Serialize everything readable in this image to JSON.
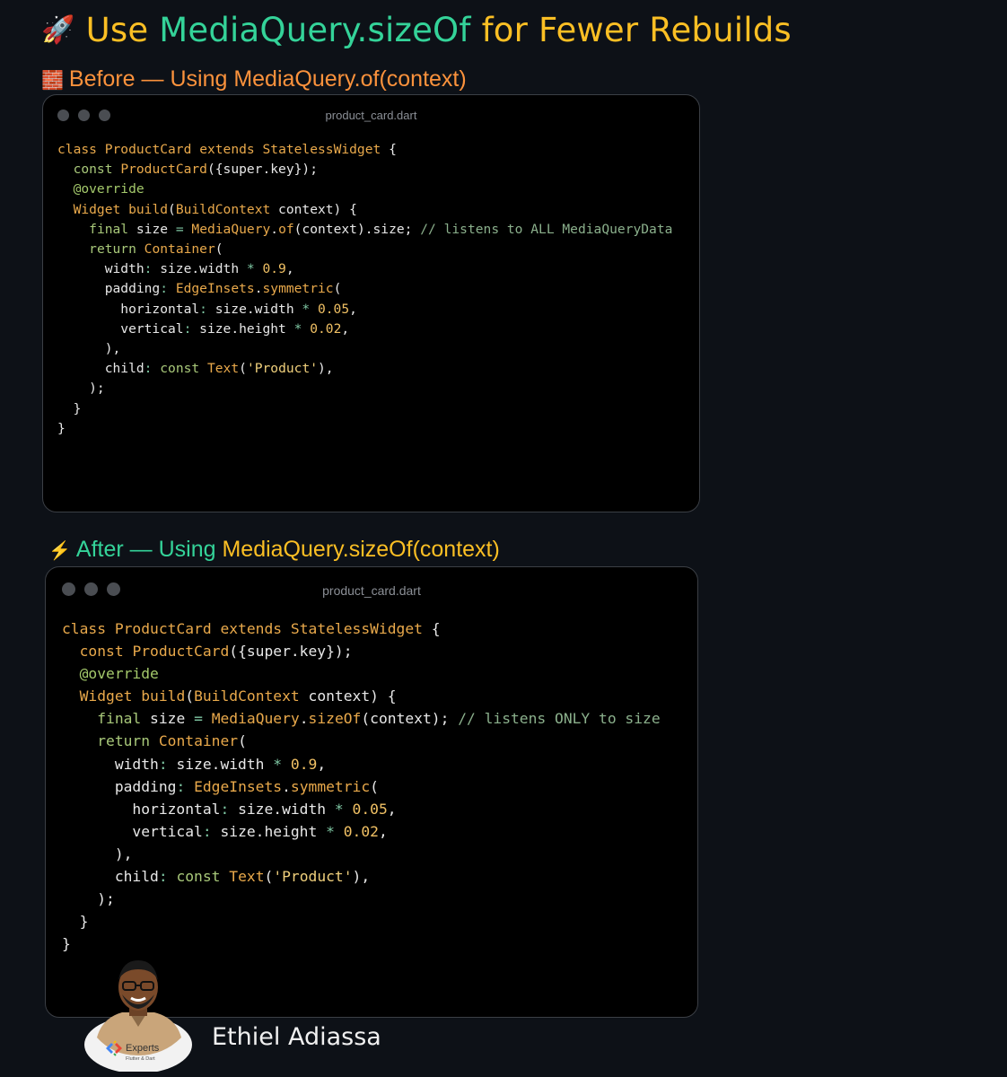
{
  "header": {
    "emoji": "🚀",
    "title_part1": "Use ",
    "title_part2": "MediaQuery.sizeOf",
    "title_part3": " for Fewer Rebuilds"
  },
  "before": {
    "emoji": "🧱",
    "label_part1": "Before — Using ",
    "label_part2": "MediaQuery.of(context)",
    "filename": "product_card.dart",
    "code_lines": [
      [
        [
          "kw",
          "class"
        ],
        [
          "p",
          " "
        ],
        [
          "type",
          "ProductCard"
        ],
        [
          "p",
          " "
        ],
        [
          "kw",
          "extends"
        ],
        [
          "p",
          " "
        ],
        [
          "type",
          "StatelessWidget"
        ],
        [
          "p",
          " {"
        ]
      ],
      [
        [
          "p",
          "  "
        ],
        [
          "kw2",
          "const"
        ],
        [
          "p",
          " "
        ],
        [
          "fn",
          "ProductCard"
        ],
        [
          "p",
          "({super.key});"
        ]
      ],
      [
        [
          "p",
          ""
        ]
      ],
      [
        [
          "p",
          "  "
        ],
        [
          "ann",
          "@override"
        ]
      ],
      [
        [
          "p",
          "  "
        ],
        [
          "type",
          "Widget"
        ],
        [
          "p",
          " "
        ],
        [
          "fn",
          "build"
        ],
        [
          "p",
          "("
        ],
        [
          "type",
          "BuildContext"
        ],
        [
          "p",
          " context) {"
        ]
      ],
      [
        [
          "p",
          "    "
        ],
        [
          "kw2",
          "final"
        ],
        [
          "p",
          " size "
        ],
        [
          "op",
          "="
        ],
        [
          "p",
          " "
        ],
        [
          "type",
          "MediaQuery"
        ],
        [
          "p",
          "."
        ],
        [
          "fn",
          "of"
        ],
        [
          "p",
          "(context).size; "
        ],
        [
          "comment",
          "// listens to ALL MediaQueryData"
        ]
      ],
      [
        [
          "p",
          ""
        ]
      ],
      [
        [
          "p",
          "    "
        ],
        [
          "kw2",
          "return"
        ],
        [
          "p",
          " "
        ],
        [
          "type",
          "Container"
        ],
        [
          "p",
          "("
        ]
      ],
      [
        [
          "p",
          "      width"
        ],
        [
          "op",
          ":"
        ],
        [
          "p",
          " size.width "
        ],
        [
          "op",
          "*"
        ],
        [
          "p",
          " "
        ],
        [
          "num",
          "0.9"
        ],
        [
          "p",
          ","
        ]
      ],
      [
        [
          "p",
          "      padding"
        ],
        [
          "op",
          ":"
        ],
        [
          "p",
          " "
        ],
        [
          "type",
          "EdgeInsets"
        ],
        [
          "p",
          "."
        ],
        [
          "fn",
          "symmetric"
        ],
        [
          "p",
          "("
        ]
      ],
      [
        [
          "p",
          "        horizontal"
        ],
        [
          "op",
          ":"
        ],
        [
          "p",
          " size.width "
        ],
        [
          "op",
          "*"
        ],
        [
          "p",
          " "
        ],
        [
          "num",
          "0.05"
        ],
        [
          "p",
          ","
        ]
      ],
      [
        [
          "p",
          "        vertical"
        ],
        [
          "op",
          ":"
        ],
        [
          "p",
          " size.height "
        ],
        [
          "op",
          "*"
        ],
        [
          "p",
          " "
        ],
        [
          "num",
          "0.02"
        ],
        [
          "p",
          ","
        ]
      ],
      [
        [
          "p",
          "      ),"
        ]
      ],
      [
        [
          "p",
          "      child"
        ],
        [
          "op",
          ":"
        ],
        [
          "p",
          " "
        ],
        [
          "kw2",
          "const"
        ],
        [
          "p",
          " "
        ],
        [
          "type",
          "Text"
        ],
        [
          "p",
          "("
        ],
        [
          "str",
          "'Product'"
        ],
        [
          "p",
          "),"
        ]
      ],
      [
        [
          "p",
          "    );"
        ]
      ],
      [
        [
          "p",
          "  }"
        ]
      ],
      [
        [
          "p",
          "}"
        ]
      ]
    ]
  },
  "after": {
    "emoji": "⚡",
    "label_part1": "After — Using ",
    "label_part2": "MediaQuery.sizeOf(context)",
    "filename": "product_card.dart",
    "code_lines": [
      [
        [
          "kw",
          "class"
        ],
        [
          "p",
          " "
        ],
        [
          "type",
          "ProductCard"
        ],
        [
          "p",
          " "
        ],
        [
          "kw",
          "extends"
        ],
        [
          "p",
          " "
        ],
        [
          "type",
          "StatelessWidget"
        ],
        [
          "p",
          " {"
        ]
      ],
      [
        [
          "p",
          "  "
        ],
        [
          "kw",
          "const"
        ],
        [
          "p",
          " "
        ],
        [
          "fn",
          "ProductCard"
        ],
        [
          "p",
          "({super.key});"
        ]
      ],
      [
        [
          "p",
          ""
        ]
      ],
      [
        [
          "p",
          "  "
        ],
        [
          "ann",
          "@override"
        ]
      ],
      [
        [
          "p",
          "  "
        ],
        [
          "type",
          "Widget"
        ],
        [
          "p",
          " "
        ],
        [
          "fn",
          "build"
        ],
        [
          "p",
          "("
        ],
        [
          "type",
          "BuildContext"
        ],
        [
          "p",
          " context) {"
        ]
      ],
      [
        [
          "p",
          "    "
        ],
        [
          "kw2",
          "final"
        ],
        [
          "p",
          " size "
        ],
        [
          "op",
          "="
        ],
        [
          "p",
          " "
        ],
        [
          "type",
          "MediaQuery"
        ],
        [
          "p",
          "."
        ],
        [
          "fn",
          "sizeOf"
        ],
        [
          "p",
          "(context); "
        ],
        [
          "comment",
          "// listens ONLY to size"
        ]
      ],
      [
        [
          "p",
          ""
        ]
      ],
      [
        [
          "p",
          "    "
        ],
        [
          "kw2",
          "return"
        ],
        [
          "p",
          " "
        ],
        [
          "type",
          "Container"
        ],
        [
          "p",
          "("
        ]
      ],
      [
        [
          "p",
          "      width"
        ],
        [
          "op",
          ":"
        ],
        [
          "p",
          " size.width "
        ],
        [
          "op",
          "*"
        ],
        [
          "p",
          " "
        ],
        [
          "num",
          "0.9"
        ],
        [
          "p",
          ","
        ]
      ],
      [
        [
          "p",
          "      padding"
        ],
        [
          "op",
          ":"
        ],
        [
          "p",
          " "
        ],
        [
          "type",
          "EdgeInsets"
        ],
        [
          "p",
          "."
        ],
        [
          "fn",
          "symmetric"
        ],
        [
          "p",
          "("
        ]
      ],
      [
        [
          "p",
          "        horizontal"
        ],
        [
          "op",
          ":"
        ],
        [
          "p",
          " size.width "
        ],
        [
          "op",
          "*"
        ],
        [
          "p",
          " "
        ],
        [
          "num",
          "0.05"
        ],
        [
          "p",
          ","
        ]
      ],
      [
        [
          "p",
          "        vertical"
        ],
        [
          "op",
          ":"
        ],
        [
          "p",
          " size.height "
        ],
        [
          "op",
          "*"
        ],
        [
          "p",
          " "
        ],
        [
          "num",
          "0.02"
        ],
        [
          "p",
          ","
        ]
      ],
      [
        [
          "p",
          "      ),"
        ]
      ],
      [
        [
          "p",
          "      child"
        ],
        [
          "op",
          ":"
        ],
        [
          "p",
          " "
        ],
        [
          "kw2",
          "const"
        ],
        [
          "p",
          " "
        ],
        [
          "type",
          "Text"
        ],
        [
          "p",
          "("
        ],
        [
          "str",
          "'Product'"
        ],
        [
          "p",
          "),"
        ]
      ],
      [
        [
          "p",
          "    );"
        ]
      ],
      [
        [
          "p",
          "  }"
        ]
      ],
      [
        [
          "p",
          "}"
        ]
      ]
    ]
  },
  "author": {
    "name": "Ethiel Adiassa",
    "badge_text": "Experts",
    "badge_subtext": "Flutter & Dart"
  },
  "colors": {
    "background": "#0d1117",
    "title_yellow": "#fbbf24",
    "title_green": "#34d399",
    "before_label": "#fb923c",
    "after_label": "#34d399",
    "code_window": "#000000"
  }
}
